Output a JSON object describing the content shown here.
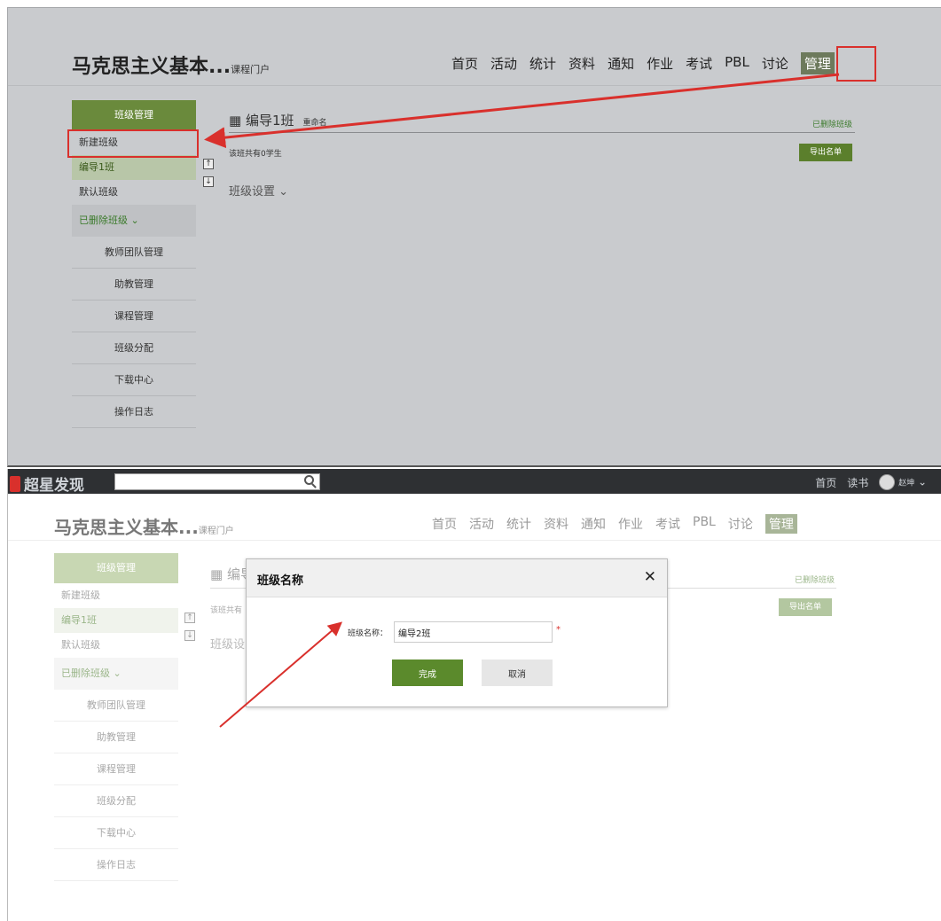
{
  "step1": {
    "course_title": "马克思主义基本...",
    "course_portal": "课程门户",
    "nav": [
      "首页",
      "活动",
      "统计",
      "资料",
      "通知",
      "作业",
      "考试",
      "PBL",
      "讨论",
      "管理"
    ],
    "sidebar": {
      "header": "班级管理",
      "new_class": "新建班级",
      "classes": [
        "编导1班",
        "默认班级"
      ],
      "deleted": "已删除班级",
      "items": [
        "教师团队管理",
        "助教管理",
        "课程管理",
        "班级分配",
        "下载中心",
        "操作日志"
      ]
    },
    "main": {
      "class_icon": "▦",
      "class_title": "编导1班",
      "rename_link": "重命名",
      "deleted_link": "已删除班级",
      "student_count": "该班共有0学生",
      "export_button": "导出名单",
      "settings": "班级设置",
      "up_arrow": "↑",
      "down_arrow": "↓"
    }
  },
  "step2": {
    "topbar": {
      "logo": "超星发现",
      "links": [
        "首页",
        "读书"
      ],
      "username": "赵坤"
    },
    "course_title": "马克思主义基本...",
    "course_portal": "课程门户",
    "nav": [
      "首页",
      "活动",
      "统计",
      "资料",
      "通知",
      "作业",
      "考试",
      "PBL",
      "讨论",
      "管理"
    ],
    "sidebar": {
      "header": "班级管理",
      "new_class": "新建班级",
      "classes": [
        "编导1班",
        "默认班级"
      ],
      "deleted": "已删除班级",
      "items": [
        "教师团队管理",
        "助教管理",
        "课程管理",
        "班级分配",
        "下载中心",
        "操作日志"
      ]
    },
    "main": {
      "class_title_partial": "编导",
      "student_partial": "该班共有",
      "settings_partial": "班级设",
      "deleted_link": "已删除班级",
      "export_button": "导出名单"
    },
    "dialog": {
      "title": "班级名称",
      "close": "✕",
      "label": "班级名称：",
      "input_value": "编导2班",
      "required_mark": "*",
      "ok_button": "完成",
      "cancel_button": "取消"
    }
  },
  "colors": {
    "annotation_red": "#d9302c",
    "brand_green": "#6a8a3c",
    "ok_green": "#5b8a2c"
  }
}
